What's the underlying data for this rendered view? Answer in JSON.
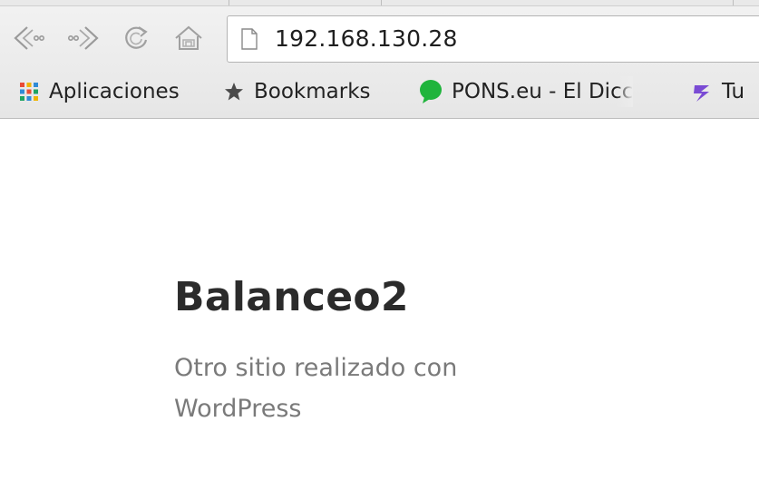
{
  "browser": {
    "address_bar": {
      "url": "192.168.130.28"
    },
    "bookmarks_bar": {
      "items": [
        {
          "label": "Aplicaciones",
          "icon": "apps-grid-icon"
        },
        {
          "label": "Bookmarks",
          "icon": "star-icon"
        },
        {
          "label": "PONS.eu - El Dicc",
          "icon": "pons-bubble-icon"
        },
        {
          "label": "Tu",
          "icon": "tutorial-logo-icon"
        }
      ]
    },
    "colors": {
      "pons_green": "#1fb43c",
      "tutorial_purple": "#7a4bd4"
    }
  },
  "page": {
    "site_title": "Balanceo2",
    "site_description": "Otro sitio realizado con WordPress"
  }
}
